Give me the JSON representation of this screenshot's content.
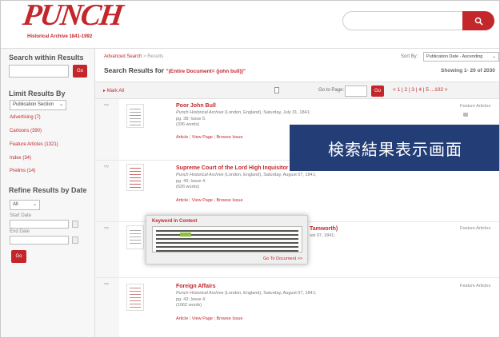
{
  "header": {
    "logo_text": "PUNCH",
    "logo_sub": "Historical Archive 1841-1992",
    "search_placeholder": ""
  },
  "sidebar": {
    "search_title": "Search within Results",
    "go_label": "Go",
    "limit_title": "Limit Results By",
    "limit_select": "Publication Section",
    "facets": [
      "Advertising (7)",
      "Cartoons (390)",
      "Feature Articles (1321)",
      "Index (34)",
      "Prelims (14)"
    ],
    "refine_title": "Refine Results by Date",
    "date_select": "All",
    "start_label": "Start Date",
    "end_label": "End Date",
    "go_label2": "Go"
  },
  "main": {
    "breadcrumb_link": "Advanced Search",
    "breadcrumb_rest": "> Results",
    "sort_label": "Sort By:",
    "sort_value": "Publication Date - Ascending",
    "results_prefix": "Search Results for",
    "results_query": "\"(Entire Document= (john bull))\"",
    "showing": "Showing 1- 20 of 2030",
    "mark_all": "Mark All",
    "goto_label": "Go to Page:",
    "go_btn": "Go",
    "pager": "< 1 | 2 | 3 | 4 | 5 ...102 >"
  },
  "results": [
    {
      "title": "Poor John Bull",
      "source": "Punch Historical Archive",
      "meta": "(London, England), Saturday, July 31, 1841;",
      "pg": "pg. 38; Issue 5.",
      "words": "(336 words)",
      "type": "Feature Articles",
      "links": [
        "Article",
        "View Page",
        "Browse Issue"
      ]
    },
    {
      "title": "Supreme Court of the Lord High Inquisitor",
      "source": "Punch Historical Archive",
      "meta": "(London, England), Saturday, August 07, 1841;",
      "pg": "pg. 40; Issue 4.",
      "words": "(626 words)",
      "type": "",
      "links": [
        "Article",
        "View Page",
        "Browse Issue"
      ]
    },
    {
      "title": "Tamworth)",
      "source": "",
      "meta": "ust 07, 1841;",
      "pg": "",
      "words": "",
      "type": "Feature Articles",
      "links": []
    },
    {
      "title": "Foreign Affairs",
      "source": "Punch Historical Archive",
      "meta": "(London, England), Saturday, August 07, 1841;",
      "pg": "pg. 42; Issue 4.",
      "words": "(1062 words)",
      "type": "Feature Articles",
      "links": [
        "Article",
        "View Page",
        "Browse Issue"
      ]
    }
  ],
  "popup": {
    "title": "Keyword in Context",
    "link": "Go To Document >>"
  },
  "overlay_label": "検索結果表示画面",
  "colors": {
    "accent": "#c3262b",
    "overlay": "#233d77"
  }
}
